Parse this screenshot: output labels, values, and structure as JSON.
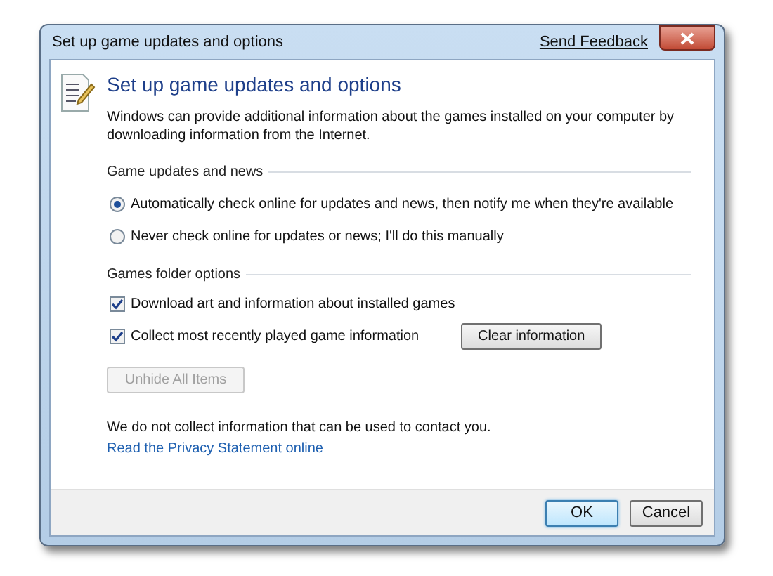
{
  "window": {
    "title": "Set up game updates and options",
    "link": "Send Feedback"
  },
  "heading": "Set up game updates and options",
  "intro": "Windows can provide additional information about the games installed on your computer by downloading information from the Internet.",
  "updates": {
    "label": "Game updates and news",
    "options": [
      {
        "label": "Automatically check online for updates and news, then notify me when they're available",
        "selected": true
      },
      {
        "label": "Never check online for updates or news; I'll do this manually",
        "selected": false
      }
    ]
  },
  "folder": {
    "label": "Games folder options",
    "checkboxes": [
      {
        "label": "Download art and information about installed games",
        "checked": true
      },
      {
        "label": "Collect most recently played game information",
        "checked": true,
        "button": {
          "label": "Clear information",
          "disabled": false
        }
      }
    ],
    "button": {
      "label": "Unhide All Items",
      "disabled": true
    }
  },
  "privacy_note": "We do not collect information that can be used to contact you.",
  "privacy_link": "Read the Privacy Statement online",
  "footer_buttons": [
    {
      "label": "OK",
      "default": true
    },
    {
      "label": "Cancel",
      "default": false
    }
  ]
}
